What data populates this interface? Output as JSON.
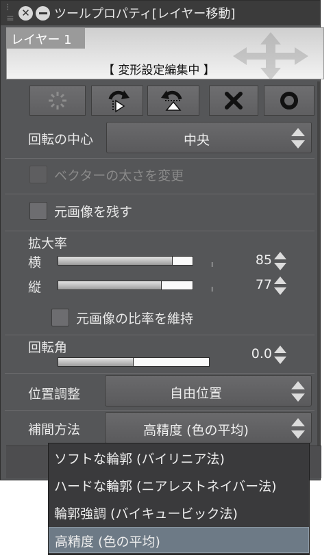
{
  "window": {
    "title": "ツールプロパティ[レイヤー移動]"
  },
  "preview": {
    "layer_name": "レイヤー 1",
    "status": "【 変形設定編集中 】"
  },
  "toolbar": {
    "buttons": [
      "rotate-reset-icon",
      "rotate-cw-icon",
      "rotate-ccw-icon",
      "close-icon",
      "confirm-icon"
    ]
  },
  "rotation_center": {
    "label": "回転の中心",
    "value": "中央"
  },
  "vector_width": {
    "label": "ベクターの太さを変更",
    "checked": false,
    "enabled": false
  },
  "keep_original": {
    "label": "元画像を残す",
    "checked": false
  },
  "scale": {
    "label": "拡大率",
    "horizontal_label": "横",
    "horizontal_value": "85",
    "horizontal_level": 0.85,
    "vertical_label": "縦",
    "vertical_value": "77",
    "vertical_level": 0.77,
    "keep_ratio_label": "元画像の比率を維持",
    "keep_ratio_checked": false
  },
  "rotation_angle": {
    "label": "回転角",
    "value": "0.0",
    "level": 0.5
  },
  "position_adjust": {
    "label": "位置調整",
    "value": "自由位置"
  },
  "interpolation": {
    "label": "補間方法",
    "value": "高精度 (色の平均)",
    "options": [
      "ソフトな輪郭 (バイリニア法)",
      "ハードな輪郭 (ニアレストネイバー法)",
      "輪郭強調 (バイキュービック法)",
      "高精度 (色の平均)"
    ],
    "selected_index": 3
  },
  "colors": {
    "panel_bg": "#555658",
    "titlebar_bg": "#3b3b3b",
    "selected_item": "#6d7a86"
  }
}
